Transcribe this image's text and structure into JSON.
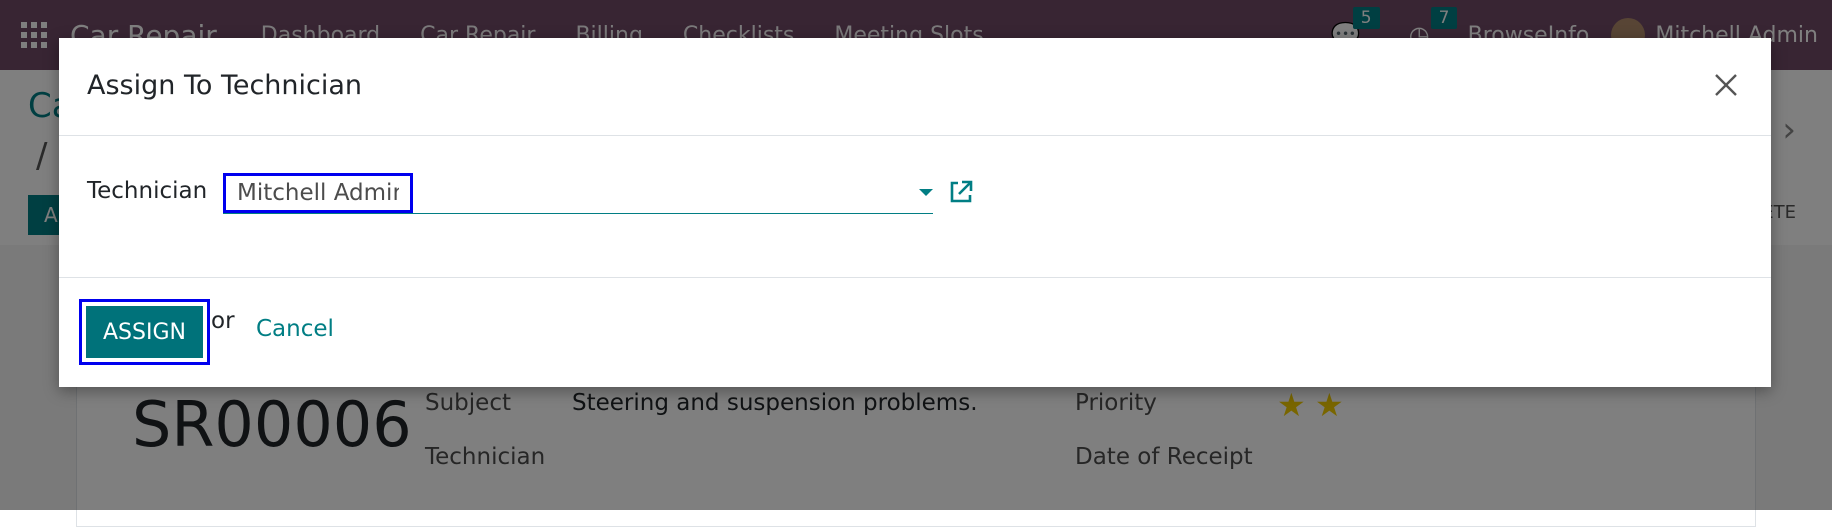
{
  "navbar": {
    "brand": "Car Repair",
    "menu": [
      "Dashboard",
      "Car Repair",
      "Billing",
      "Checklists",
      "Meeting Slots"
    ],
    "messages_count": "5",
    "activities_count": "7",
    "company": "BrowseInfo",
    "user": "Mitchell Admin"
  },
  "control_panel": {
    "breadcrumb_first": "Ca",
    "breadcrumb_second": "/",
    "create_label": "A",
    "delete_label": "ETE"
  },
  "record": {
    "reference": "SR00006",
    "subject_label": "Subject",
    "subject_value": "Steering and suspension problems.",
    "technician_label": "Technician",
    "priority_label": "Priority",
    "priority_stars": 2,
    "date_label": "Date of Receipt"
  },
  "dialog": {
    "title": "Assign To Technician",
    "technician_label": "Technician",
    "technician_value": "Mitchell Admin",
    "assign_label": "ASSIGN",
    "or_text": "or",
    "cancel_label": "Cancel"
  },
  "colors": {
    "navbar": "#714b67",
    "primary": "#017e84",
    "highlight": "#0000ee",
    "star": "#f3cc00"
  }
}
